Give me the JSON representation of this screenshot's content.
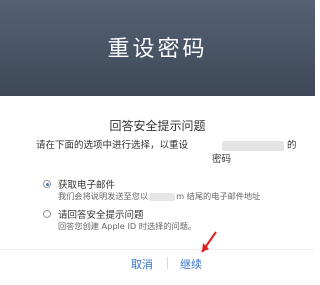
{
  "header": {
    "title": "重设密码"
  },
  "dialog": {
    "question_title": "回答安全提示问题",
    "instruction_part1": "请在下面的选项中进行选择，以重设",
    "instruction_part2": "的",
    "instruction_line2": "密码"
  },
  "options": [
    {
      "label": "获取电子邮件",
      "desc_before": "我们会将说明发送至您以",
      "desc_after": "m 结尾的电子邮件地址",
      "selected": true
    },
    {
      "label": "请回答安全提示问题",
      "desc": "回答您创建 Apple ID 时选择的问题。",
      "selected": false
    }
  ],
  "buttons": {
    "cancel": "取消",
    "continue": "继续"
  },
  "colors": {
    "header_bg": "#4b5668",
    "link": "#3474cf",
    "arrow": "#e02020"
  }
}
